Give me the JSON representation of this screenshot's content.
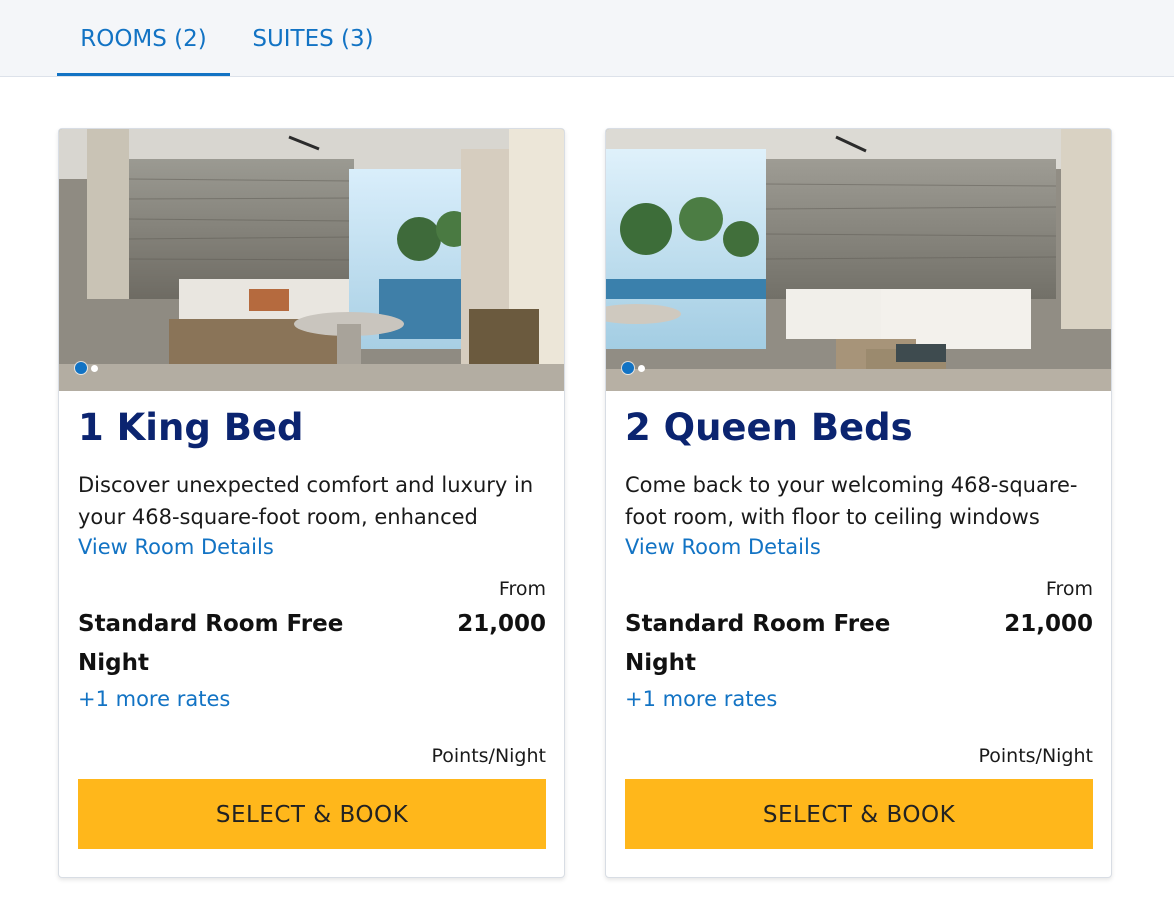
{
  "tabs": [
    {
      "label": "ROOMS (2)",
      "active": true
    },
    {
      "label": "SUITES (3)",
      "active": false
    }
  ],
  "rooms": [
    {
      "title": "1 King Bed",
      "description": "Discover unexpected comfort and luxury in your 468-square-foot room, enhanced with...",
      "details_link": "View Room Details",
      "from_label": "From",
      "rate_name": "Standard Room Free Night",
      "points": "21,000",
      "more_rates": "+1 more rates",
      "points_unit": "Points/Night",
      "button": "SELECT & BOOK"
    },
    {
      "title": "2 Queen Beds",
      "description": "Come back to your welcoming 468-square-foot room, with floor to ceiling windows revealing...",
      "details_link": "View Room Details",
      "from_label": "From",
      "rate_name": "Standard Room Free Night",
      "points": "21,000",
      "more_rates": "+1 more rates",
      "points_unit": "Points/Night",
      "button": "SELECT & BOOK"
    }
  ],
  "colors": {
    "accent": "#1273c4",
    "title": "#0b2470",
    "button": "#ffb71b"
  }
}
